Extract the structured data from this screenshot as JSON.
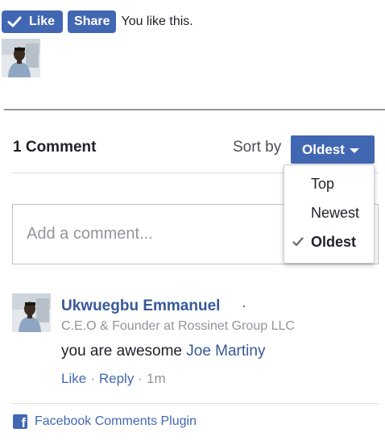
{
  "like_bar": {
    "like_label": "Like",
    "share_label": "Share",
    "status_text": "You like this."
  },
  "comments": {
    "count_label": "1 Comment",
    "sort_label": "Sort by",
    "sort_selected": "Oldest",
    "sort_options": [
      "Top",
      "Newest",
      "Oldest"
    ],
    "input_placeholder": "Add a comment...",
    "items": [
      {
        "author": "Ukwuegbu Emmanuel",
        "separator": "·",
        "title": "C.E.O & Founder at Rossinet Group LLC",
        "text": "you are awesome",
        "mention": "Joe Martiny",
        "like_label": "Like",
        "reply_label": "Reply",
        "dot": "·",
        "time": "1m"
      }
    ]
  },
  "footer": {
    "plugin_label": "Facebook Comments Plugin"
  },
  "colors": {
    "brand": "#4267b2",
    "link": "#385898",
    "muted": "#90949c"
  },
  "icons": {
    "check": "check-icon",
    "caret": "caret-down-icon",
    "facebook": "facebook-icon",
    "avatar": "user-avatar"
  }
}
